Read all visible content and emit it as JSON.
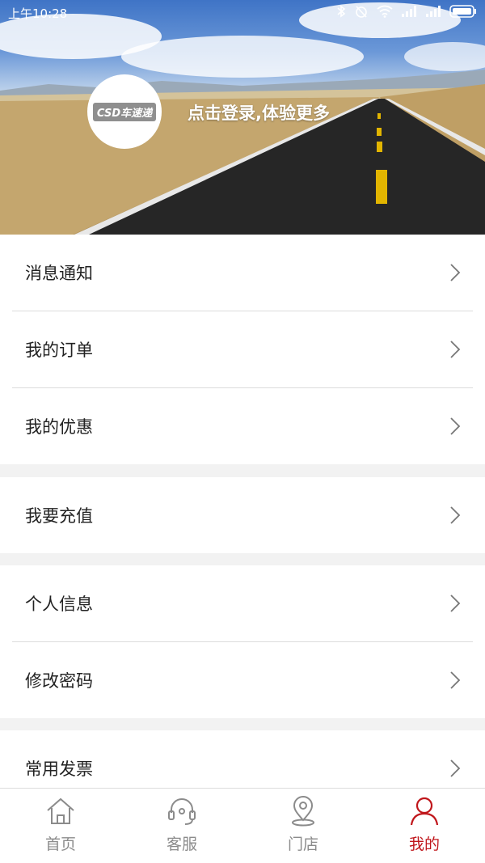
{
  "status_bar": {
    "time": "上午10:28"
  },
  "profile": {
    "avatar_logo_text": "CSD车速递",
    "login_prompt": "点击登录,体验更多"
  },
  "menu_groups": [
    {
      "items": [
        {
          "label": "消息通知"
        },
        {
          "label": "我的订单"
        },
        {
          "label": "我的优惠"
        }
      ]
    },
    {
      "items": [
        {
          "label": "我要充值"
        }
      ]
    },
    {
      "items": [
        {
          "label": "个人信息"
        },
        {
          "label": "修改密码"
        }
      ]
    },
    {
      "items": [
        {
          "label": "常用发票"
        }
      ]
    }
  ],
  "tabbar": {
    "tabs": [
      {
        "label": "首页",
        "icon": "home-icon",
        "active": false
      },
      {
        "label": "客服",
        "icon": "headset-icon",
        "active": false
      },
      {
        "label": "门店",
        "icon": "location-pin-icon",
        "active": false
      },
      {
        "label": "我的",
        "icon": "person-icon",
        "active": true
      }
    ]
  },
  "colors": {
    "accent": "#c0161b",
    "inactive_tab": "#8b8b8b",
    "divider": "#dcdcdc",
    "section_gap": "#f2f2f2"
  }
}
